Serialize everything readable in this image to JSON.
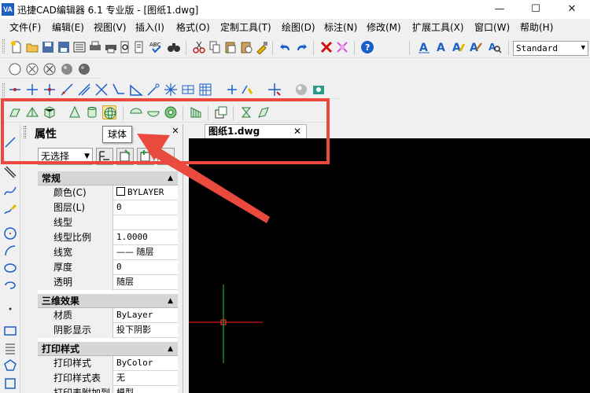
{
  "window": {
    "logo_text": "VA",
    "title": "迅捷CAD编辑器 6.1 专业版  - [图纸1.dwg]",
    "min_glyph": "—",
    "max_glyph": "☐",
    "close_glyph": "✕"
  },
  "menu": {
    "items": [
      {
        "label": "文件(F)"
      },
      {
        "label": "编辑(E)"
      },
      {
        "label": "视图(V)"
      },
      {
        "label": "插入(I)"
      },
      {
        "label": "格式(O)"
      },
      {
        "label": "定制工具(T)"
      },
      {
        "label": "绘图(D)"
      },
      {
        "label": "标注(N)"
      },
      {
        "label": "修改(M)"
      },
      {
        "label": "扩展工具(X)"
      },
      {
        "label": "窗口(W)"
      },
      {
        "label": "帮助(H)"
      }
    ]
  },
  "toolbar": {
    "text_style": "Standard",
    "arrow_glyph": "▼"
  },
  "tooltip": {
    "text": "球体"
  },
  "properties": {
    "title": "属性",
    "close_glyph": "✕",
    "selection": "无选择",
    "sections": [
      {
        "title": "常规",
        "rows": [
          {
            "name": "颜色(C)",
            "value": "BYLAYER",
            "swatch": true
          },
          {
            "name": "图层(L)",
            "value": "0"
          },
          {
            "name": "线型",
            "value": ""
          },
          {
            "name": "线型比例",
            "value": "1.0000"
          },
          {
            "name": "线宽",
            "value": "—— 随层"
          },
          {
            "name": "厚度",
            "value": "0"
          },
          {
            "name": "透明",
            "value": "随层"
          }
        ]
      },
      {
        "title": "三维效果",
        "rows": [
          {
            "name": "材质",
            "value": "ByLayer"
          },
          {
            "name": "阴影显示",
            "value": "投下阴影"
          }
        ]
      },
      {
        "title": "打印样式",
        "rows": [
          {
            "name": "打印样式",
            "value": "ByColor"
          },
          {
            "name": "打印样式表",
            "value": "无"
          },
          {
            "name": "打印表附加到",
            "value": "模型"
          }
        ]
      }
    ],
    "caret_glyph": "▲"
  },
  "document": {
    "tab_label": "图纸1.dwg",
    "tab_close": "✕"
  },
  "colors": {
    "accent_red": "#ea4a3e",
    "crosshair_x": "#ff2020",
    "crosshair_y": "#20d020",
    "canvas_bg": "#000000"
  }
}
